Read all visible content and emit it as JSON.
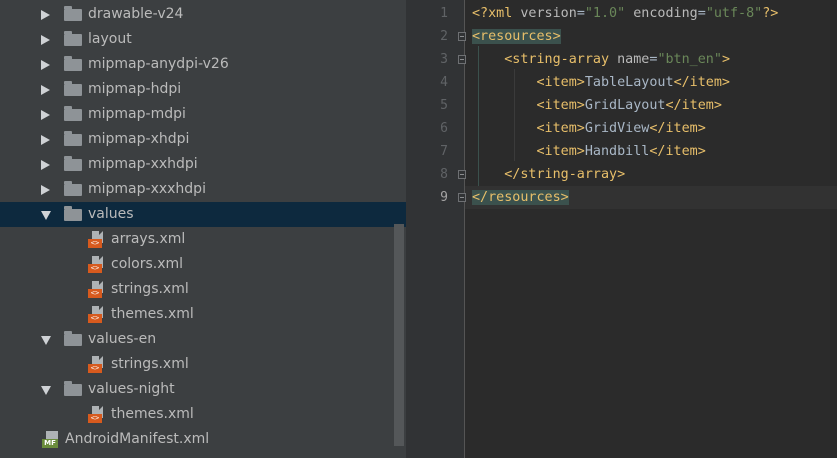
{
  "tree": {
    "items": [
      {
        "label": "drawable-v24",
        "icon": "folder-icon",
        "expand": "collapsed-arrow-icon"
      },
      {
        "label": "layout",
        "icon": "folder-icon",
        "expand": "collapsed-arrow-icon"
      },
      {
        "label": "mipmap-anydpi-v26",
        "icon": "folder-icon",
        "expand": "collapsed-arrow-icon"
      },
      {
        "label": "mipmap-hdpi",
        "icon": "folder-icon",
        "expand": "collapsed-arrow-icon"
      },
      {
        "label": "mipmap-mdpi",
        "icon": "folder-icon",
        "expand": "collapsed-arrow-icon"
      },
      {
        "label": "mipmap-xhdpi",
        "icon": "folder-icon",
        "expand": "collapsed-arrow-icon"
      },
      {
        "label": "mipmap-xxhdpi",
        "icon": "folder-icon",
        "expand": "collapsed-arrow-icon"
      },
      {
        "label": "mipmap-xxxhdpi",
        "icon": "folder-icon",
        "expand": "collapsed-arrow-icon"
      },
      {
        "label": "values",
        "icon": "folder-icon",
        "expand": "expanded-arrow-icon",
        "selected": true
      },
      {
        "label": "arrays.xml",
        "icon": "xml-file-icon"
      },
      {
        "label": "colors.xml",
        "icon": "xml-file-icon"
      },
      {
        "label": "strings.xml",
        "icon": "xml-file-icon"
      },
      {
        "label": "themes.xml",
        "icon": "xml-file-icon"
      },
      {
        "label": "values-en",
        "icon": "folder-icon",
        "expand": "expanded-arrow-icon"
      },
      {
        "label": "strings.xml",
        "icon": "xml-file-icon"
      },
      {
        "label": "values-night",
        "icon": "folder-icon",
        "expand": "expanded-arrow-icon"
      },
      {
        "label": "themes.xml",
        "icon": "xml-file-icon"
      },
      {
        "label": "AndroidManifest.xml",
        "icon": "manifest-file-icon"
      }
    ],
    "xml_badge": "<>",
    "manifest_badge": "MF"
  },
  "editor": {
    "current_line": 9,
    "lines": [
      {
        "n": "1",
        "parts": [
          [
            "t",
            "<?xml "
          ],
          [
            "a",
            "version"
          ],
          [
            "x",
            "="
          ],
          [
            "v",
            "\"1.0\""
          ],
          [
            "a",
            " encoding"
          ],
          [
            "x",
            "="
          ],
          [
            "v",
            "\"utf-8\""
          ],
          [
            "t",
            "?>"
          ]
        ]
      },
      {
        "n": "2",
        "parts": [
          [
            "th",
            "<resources>"
          ]
        ]
      },
      {
        "n": "3",
        "parts": [
          [
            "x",
            "    "
          ],
          [
            "t",
            "<string-array "
          ],
          [
            "a",
            "name"
          ],
          [
            "x",
            "="
          ],
          [
            "v",
            "\"btn_en\""
          ],
          [
            "t",
            ">"
          ]
        ]
      },
      {
        "n": "4",
        "parts": [
          [
            "x",
            "        "
          ],
          [
            "t",
            "<item>"
          ],
          [
            "x",
            "TableLayout"
          ],
          [
            "t",
            "</item>"
          ]
        ]
      },
      {
        "n": "5",
        "parts": [
          [
            "x",
            "        "
          ],
          [
            "t",
            "<item>"
          ],
          [
            "x",
            "GridLayout"
          ],
          [
            "t",
            "</item>"
          ]
        ]
      },
      {
        "n": "6",
        "parts": [
          [
            "x",
            "        "
          ],
          [
            "t",
            "<item>"
          ],
          [
            "x",
            "GridView"
          ],
          [
            "t",
            "</item>"
          ]
        ]
      },
      {
        "n": "7",
        "parts": [
          [
            "x",
            "        "
          ],
          [
            "t",
            "<item>"
          ],
          [
            "x",
            "Handbill"
          ],
          [
            "t",
            "</item>"
          ]
        ]
      },
      {
        "n": "8",
        "parts": [
          [
            "x",
            "    "
          ],
          [
            "t",
            "</string-array>"
          ]
        ]
      },
      {
        "n": "9",
        "parts": [
          [
            "th",
            "</resources>"
          ]
        ]
      }
    ]
  },
  "colors": {
    "tag": "#e8bf6a",
    "attribute": "#bababa",
    "value": "#6a8759",
    "text": "#a9b7c6",
    "selection": "#0d293e",
    "tag_highlight": "#3b514d"
  }
}
